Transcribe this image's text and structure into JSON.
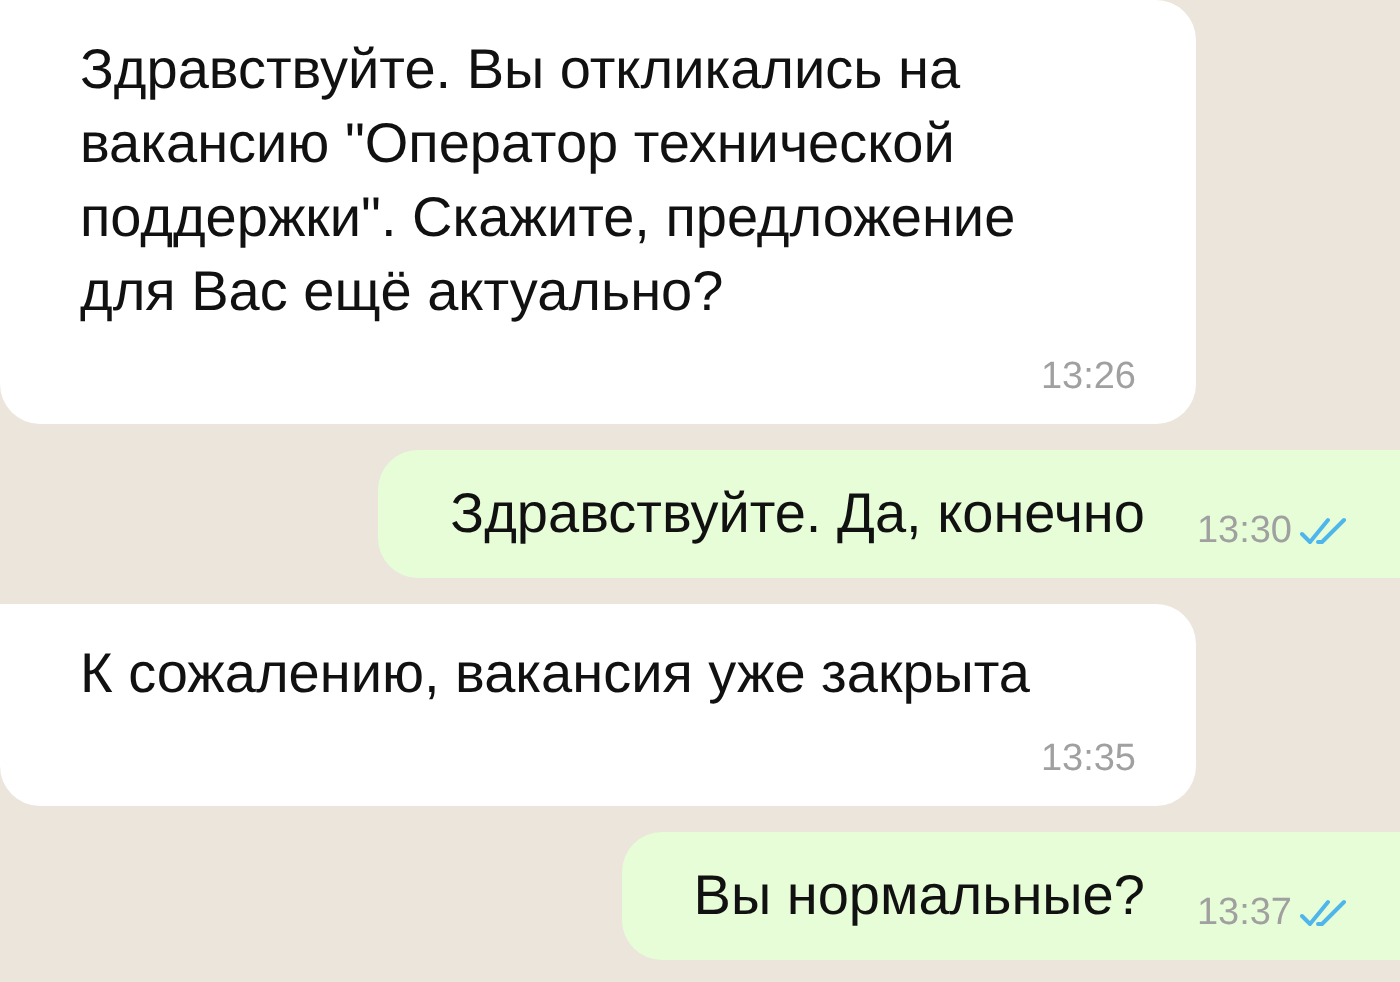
{
  "messages": [
    {
      "kind": "in",
      "text": "Здравствуйте. Вы откликались на вакансию \"Оператор технической поддержки\". Скажите, предложение для Вас ещё актуально?",
      "time": "13:26"
    },
    {
      "kind": "out",
      "text": "Здравствуйте. Да, конечно",
      "time": "13:30",
      "read": true
    },
    {
      "kind": "in",
      "text": "К сожалению, вакансия уже закрыта",
      "time": "13:35"
    },
    {
      "kind": "out",
      "text": "Вы нормальные?",
      "time": "13:37",
      "read": true
    }
  ]
}
